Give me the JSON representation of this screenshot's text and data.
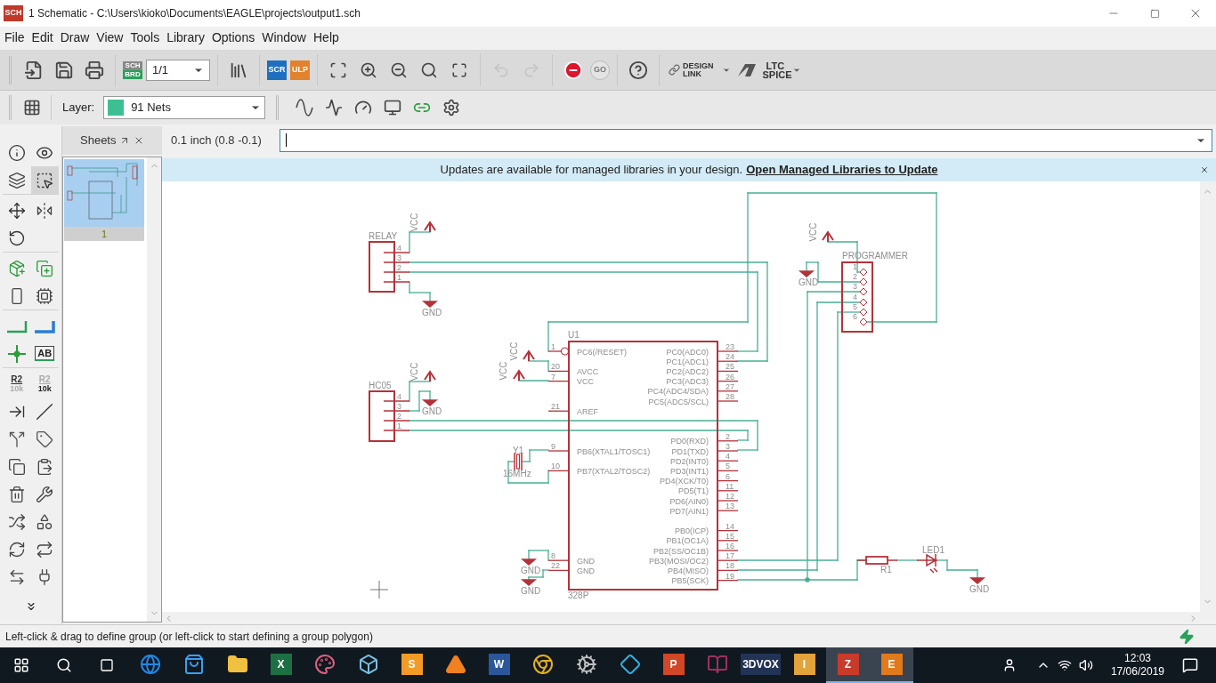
{
  "window": {
    "icon_text": "SCH",
    "title": "1 Schematic - C:\\Users\\kioko\\Documents\\EAGLE\\projects\\output1.sch"
  },
  "menu": [
    "File",
    "Edit",
    "Draw",
    "View",
    "Tools",
    "Library",
    "Options",
    "Window",
    "Help"
  ],
  "toolbar": [
    {
      "kind": "new",
      "disabled": false
    },
    {
      "kind": "save",
      "disabled": false
    },
    {
      "kind": "print",
      "disabled": false
    },
    {
      "kind": "sch_brd",
      "text": [
        "SCH",
        "BRD"
      ],
      "disabled": false
    },
    {
      "kind": "sheet_select",
      "value": "1/1",
      "disabled": false
    },
    {
      "kind": "library",
      "disabled": false
    },
    {
      "kind": "scr",
      "text": [
        "SCR"
      ],
      "disabled": false
    },
    {
      "kind": "ulp",
      "text": [
        "ULP"
      ],
      "disabled": false
    },
    {
      "kind": "zoom_fit",
      "disabled": false
    },
    {
      "kind": "zoom_in",
      "disabled": false
    },
    {
      "kind": "zoom_out",
      "disabled": false
    },
    {
      "kind": "zoom_redraw",
      "disabled": false
    },
    {
      "kind": "zoom_select",
      "disabled": false
    },
    {
      "kind": "undo",
      "disabled": true
    },
    {
      "kind": "redo",
      "disabled": true
    },
    {
      "kind": "stop",
      "disabled": false
    },
    {
      "kind": "go",
      "text": [
        "GO"
      ],
      "disabled": true
    },
    {
      "kind": "help",
      "disabled": false
    },
    {
      "kind": "design_link",
      "text": [
        "DESIGN",
        "LINK"
      ],
      "disabled": false
    },
    {
      "kind": "ltspice",
      "text": [
        "LTC",
        "SPICE"
      ],
      "disabled": false
    }
  ],
  "toolbar2": {
    "layer_label": "Layer:",
    "layer": "91 Nets",
    "tools": [
      {
        "kind": "grid"
      },
      {
        "kind": "sine"
      },
      {
        "kind": "probe"
      },
      {
        "kind": "meter"
      },
      {
        "kind": "meter2"
      },
      {
        "kind": "link_add"
      },
      {
        "kind": "settings"
      }
    ]
  },
  "sheets_panel": {
    "title": "Sheets",
    "sheets": [
      {
        "label": "1",
        "selected": true
      }
    ]
  },
  "grid_readout": "0.1 inch (0.8 -0.1)",
  "notification": {
    "text": "Updates are available for managed libraries in your design.",
    "link": "Open Managed Libraries to Update"
  },
  "tools": [
    [
      {
        "kind": "info",
        "selected": false
      },
      {
        "kind": "eye",
        "selected": false
      },
      {
        "kind": "layers",
        "selected": false
      },
      {
        "kind": "select",
        "selected": true
      }
    ],
    [
      {
        "kind": "move",
        "selected": false
      },
      {
        "kind": "mirror",
        "selected": false
      },
      {
        "kind": "rotate",
        "selected": false
      }
    ],
    [
      {
        "kind": "add",
        "selected": false
      },
      {
        "kind": "add_gate",
        "selected": false
      },
      {
        "kind": "replace",
        "selected": false
      },
      {
        "kind": "smash",
        "selected": false
      }
    ],
    [
      {
        "kind": "wire",
        "selected": false
      },
      {
        "kind": "bus",
        "selected": false
      },
      {
        "kind": "junction",
        "selected": false
      },
      {
        "kind": "label",
        "text": [
          "AB"
        ],
        "selected": false
      }
    ],
    [
      {
        "kind": "name",
        "text": [
          "R2",
          "10k"
        ],
        "selected": false
      },
      {
        "kind": "value",
        "text": [
          "R2",
          "10k"
        ],
        "selected": false
      },
      {
        "kind": "pinswap",
        "selected": false
      },
      {
        "kind": "line",
        "selected": false
      },
      {
        "kind": "split",
        "selected": false
      },
      {
        "kind": "attribute",
        "selected": false
      },
      {
        "kind": "copy",
        "selected": false
      },
      {
        "kind": "paste",
        "selected": false
      },
      {
        "kind": "delete",
        "selected": false
      },
      {
        "kind": "wrench",
        "selected": false
      },
      {
        "kind": "gateswap",
        "selected": false
      },
      {
        "kind": "replace2",
        "selected": false
      },
      {
        "kind": "rotate_connect",
        "selected": false
      },
      {
        "kind": "swap",
        "selected": false
      },
      {
        "kind": "miter",
        "selected": false
      },
      {
        "kind": "plug",
        "selected": false
      }
    ]
  ],
  "schematic": {
    "connectors": [
      {
        "name": "RELAY",
        "pins": [
          "4",
          "3",
          "2",
          "1"
        ]
      },
      {
        "name": "HC05",
        "pins": [
          "4",
          "3",
          "2",
          "1"
        ]
      }
    ],
    "mcu": {
      "name": "U1",
      "value": "328P",
      "left_pins": [
        {
          "number": "1",
          "label": "PC6(/RESET)"
        },
        {
          "number": "20",
          "label": "AVCC"
        },
        {
          "number": "7",
          "label": "VCC"
        },
        {
          "number": "21",
          "label": "AREF"
        },
        {
          "number": "9",
          "label": "PB6(XTAL1/TOSC1)"
        },
        {
          "number": "10",
          "label": "PB7(XTAL2/TOSC2)"
        },
        {
          "number": "8",
          "label": "GND"
        },
        {
          "number": "22",
          "label": "GND"
        }
      ],
      "right_pins": [
        {
          "number": "23",
          "label": "PC0(ADC0)"
        },
        {
          "number": "24",
          "label": "PC1(ADC1)"
        },
        {
          "number": "25",
          "label": "PC2(ADC2)"
        },
        {
          "number": "26",
          "label": "PC3(ADC3)"
        },
        {
          "number": "27",
          "label": "PC4(ADC4/SDA)"
        },
        {
          "number": "28",
          "label": "PC5(ADC5/SCL)"
        },
        {
          "number": "2",
          "label": "PD0(RXD)"
        },
        {
          "number": "3",
          "label": "PD1(TXD)"
        },
        {
          "number": "4",
          "label": "PD2(INT0)"
        },
        {
          "number": "5",
          "label": "PD3(INT1)"
        },
        {
          "number": "6",
          "label": "PD4(XCK/T0)"
        },
        {
          "number": "11",
          "label": "PD5(T1)"
        },
        {
          "number": "12",
          "label": "PD6(AIN0)"
        },
        {
          "number": "13",
          "label": "PD7(AIN1)"
        },
        {
          "number": "14",
          "label": "PB0(ICP)"
        },
        {
          "number": "15",
          "label": "PB1(OC1A)"
        },
        {
          "number": "16",
          "label": "PB2(SS/OC1B)"
        },
        {
          "number": "17",
          "label": "PB3(MOSI/OC2)"
        },
        {
          "number": "18",
          "label": "PB4(MISO)"
        },
        {
          "number": "19",
          "label": "PB5(SCK)"
        }
      ]
    },
    "programmer": {
      "name": "PROGRAMMER",
      "pins": [
        "1",
        "2",
        "3",
        "4",
        "5",
        "6"
      ]
    },
    "crystal": {
      "name": "Y1",
      "value": "16MHz"
    },
    "resistor": {
      "name": "R1"
    },
    "led": {
      "name": "LED1"
    },
    "supplies": [
      {
        "kind": "vcc",
        "label": "VCC"
      },
      {
        "kind": "gnd",
        "label": "GND"
      },
      {
        "kind": "vcc",
        "label": "VCC"
      },
      {
        "kind": "gnd",
        "label": "GND"
      },
      {
        "kind": "vcc",
        "label": "VCC"
      },
      {
        "kind": "vcc",
        "label": "VCC"
      },
      {
        "kind": "gnd",
        "label": "GND"
      },
      {
        "kind": "gnd",
        "label": "GND"
      },
      {
        "kind": "vcc",
        "label": "VCC"
      },
      {
        "kind": "gnd",
        "label": "GND"
      },
      {
        "kind": "gnd",
        "label": "GND"
      }
    ]
  },
  "status_bar": "Left-click & drag to define group (or left-click to start defining a group polygon)",
  "taskbar": {
    "apps": [
      {
        "kind": "edge",
        "active": false
      },
      {
        "kind": "store",
        "active": false
      },
      {
        "kind": "folder",
        "active": false
      },
      {
        "kind": "tile",
        "glyph": "X",
        "color": "#1d7044",
        "active": false
      },
      {
        "kind": "paint",
        "active": false
      },
      {
        "kind": "cube",
        "active": false
      },
      {
        "kind": "tile",
        "glyph": "S",
        "color": "#f29b26",
        "active": false
      },
      {
        "kind": "cone",
        "active": false
      },
      {
        "kind": "tile",
        "glyph": "W",
        "color": "#2b579a",
        "active": false
      },
      {
        "kind": "chrome",
        "active": false
      },
      {
        "kind": "gear",
        "active": false
      },
      {
        "kind": "diamond",
        "active": false
      },
      {
        "kind": "tile",
        "glyph": "P",
        "color": "#d24726",
        "active": false
      },
      {
        "kind": "books",
        "active": false
      },
      {
        "kind": "tile",
        "glyph": "3DVOX",
        "color": "#223355",
        "active": false
      },
      {
        "kind": "tile",
        "glyph": "I",
        "color": "#e2a33a",
        "active": false
      },
      {
        "kind": "tile",
        "glyph": "Z",
        "color": "#c83a2a",
        "active": true
      },
      {
        "kind": "tile",
        "glyph": "E",
        "color": "#e07a1a",
        "active": true
      }
    ],
    "time": "12:03",
    "date": "17/06/2019"
  }
}
